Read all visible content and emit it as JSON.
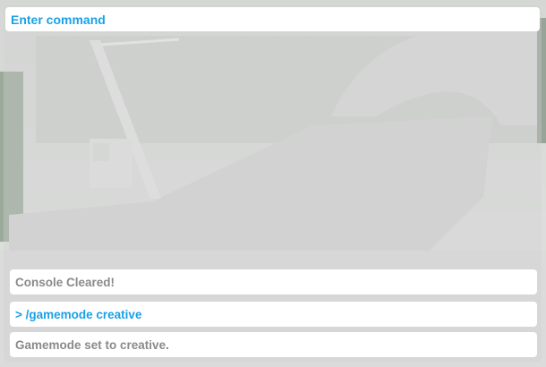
{
  "console": {
    "input_label": "Enter command",
    "log": [
      {
        "text": "Console Cleared!",
        "kind": "info"
      },
      {
        "text": "> /gamemode creative",
        "kind": "cmd"
      },
      {
        "text": "Gamemode set to creative.",
        "kind": "info"
      }
    ]
  },
  "colors": {
    "accent": "#1aa0e6",
    "info_text": "#8a8a8a"
  }
}
